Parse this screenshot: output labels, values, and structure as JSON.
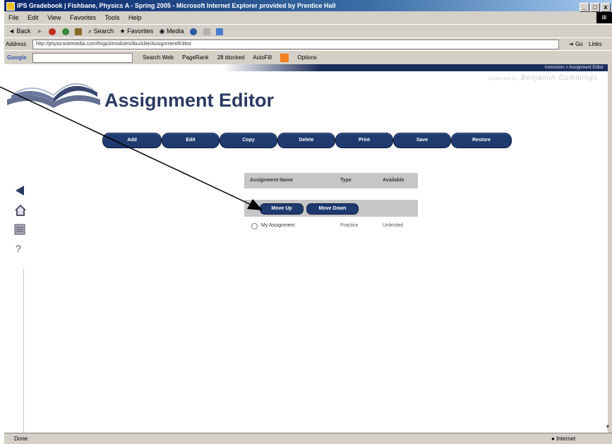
{
  "window": {
    "title": "IPS Gradebook | Fishbane, Physics A - Spring 2005 - Microsoft Internet Explorer provided by Prentice Hall",
    "controls": [
      "_",
      "□",
      "x"
    ]
  },
  "menu": [
    "File",
    "Edit",
    "View",
    "Favorites",
    "Tools",
    "Help"
  ],
  "toolbar": {
    "back": "Back",
    "search": "Search",
    "favorites": "Favorites",
    "media": "Media"
  },
  "address": {
    "label": "Address",
    "url": "http://physicsnetmedia.com/thiga3/modules/ibucklite/Assignment/Editor",
    "go": "Go",
    "links": "Links"
  },
  "google": {
    "logo": "Google",
    "search_web": "Search Web",
    "pagerank": "PageRank",
    "blocked": "28 blocked",
    "autofill": "AutoFill",
    "options": "Options"
  },
  "header": {
    "breadcrumb": "Instructors > Assignment Editor",
    "brand": "Benjamin Cummings",
    "brand_prefix": "powered by",
    "title": "Assignment Editor"
  },
  "actions": [
    "Add",
    "Edit",
    "Copy",
    "Delete",
    "Print",
    "Save",
    "Restore"
  ],
  "table": {
    "columns": [
      "Assignment Name",
      "Type",
      "Available"
    ],
    "move_up": "Move Up",
    "move_down": "Move Down",
    "rows": [
      {
        "name": "My Assignment",
        "type": "Practice",
        "available": "Unlimited"
      }
    ]
  },
  "status": {
    "text": "Done",
    "zone": "Internet"
  },
  "colors": {
    "accent": "#1e3a6e",
    "title_text": "#2b3a63",
    "table_header": "#c6c6c6"
  }
}
